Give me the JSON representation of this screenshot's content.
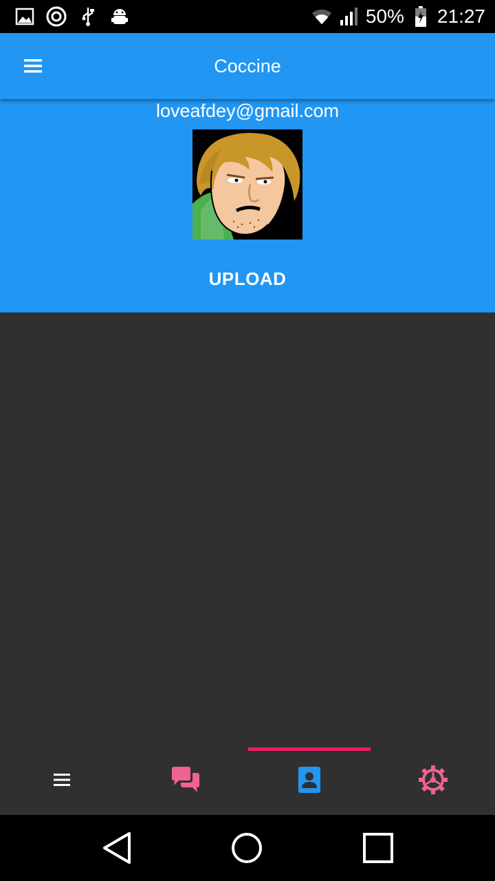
{
  "status_bar": {
    "battery_percent": "50%",
    "time": "21:27",
    "left_icons": [
      "gallery-icon",
      "aperture-icon",
      "usb-icon",
      "android-debug-icon"
    ],
    "right_icons": [
      "wifi-icon",
      "signal-icon",
      "battery-charging-icon"
    ]
  },
  "app_bar": {
    "title": "Coccine",
    "menu_icon": "hamburger-menu-icon",
    "color": "#2196F3"
  },
  "profile": {
    "email": "loveafdey@gmail.com",
    "upload_label": "UPLOAD"
  },
  "tabs": {
    "items": [
      {
        "icon": "list-icon",
        "color": "#FFFFFF"
      },
      {
        "icon": "chat-icon",
        "color": "#F06292"
      },
      {
        "icon": "contact-card-icon",
        "color": "#2196F3"
      },
      {
        "icon": "settings-gear-icon",
        "color": "#F06292"
      }
    ],
    "active_index": 2,
    "indicator_color": "#E91E63"
  },
  "nav_bar": {
    "buttons": [
      "back-icon",
      "home-icon",
      "recents-icon"
    ]
  }
}
